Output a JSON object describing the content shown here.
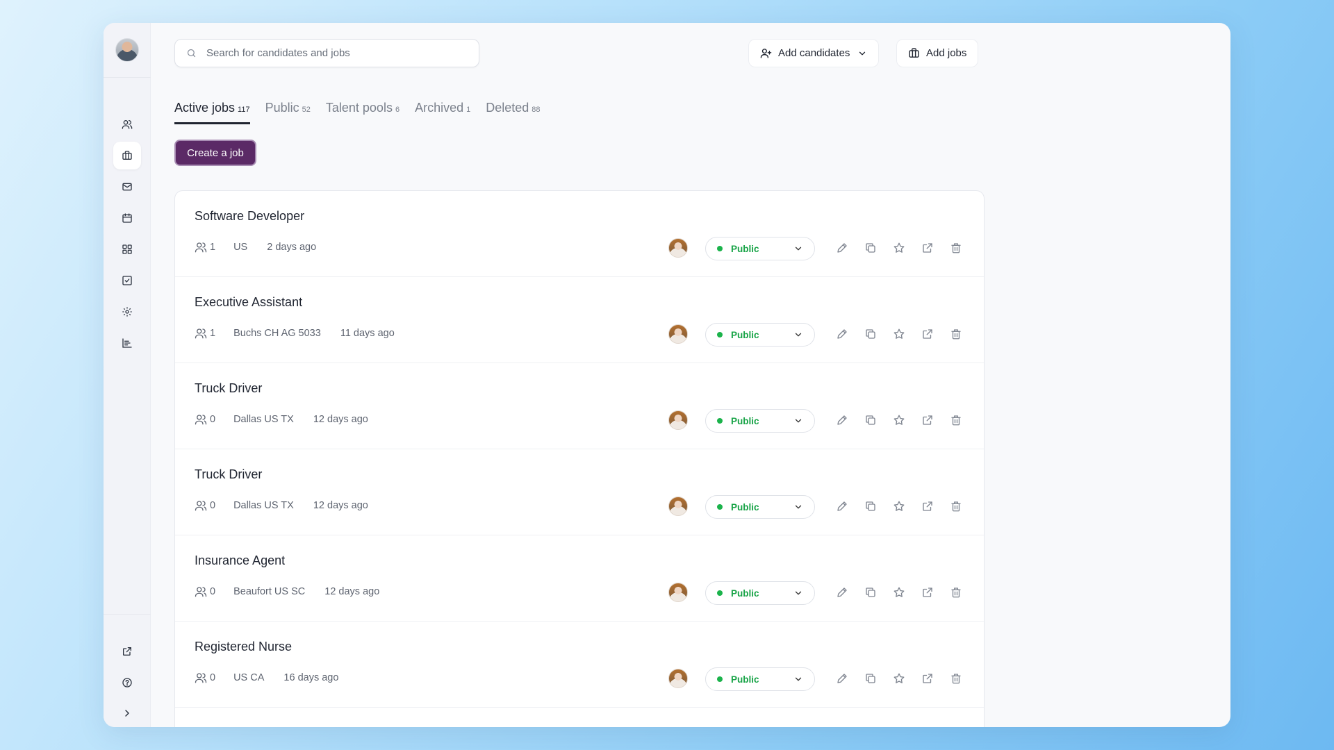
{
  "search": {
    "placeholder": "Search for candidates and jobs"
  },
  "header": {
    "add_candidates_label": "Add candidates",
    "add_jobs_label": "Add jobs"
  },
  "tabs": [
    {
      "label": "Active jobs",
      "count": "117",
      "active": true
    },
    {
      "label": "Public",
      "count": "52"
    },
    {
      "label": "Talent pools",
      "count": "6"
    },
    {
      "label": "Archived",
      "count": "1"
    },
    {
      "label": "Deleted",
      "count": "88"
    }
  ],
  "create_job_label": "Create a job",
  "sidebar": {
    "icons": [
      "users-icon",
      "briefcase-icon",
      "mail-icon",
      "calendar-icon",
      "apps-icon",
      "checkbox-icon",
      "gear-icon",
      "chart-icon"
    ],
    "bottom_icons": [
      "external-link-icon",
      "help-icon",
      "chevron-right-icon"
    ]
  },
  "jobs": [
    {
      "title": "Software Developer",
      "candidates": "1",
      "location": "US",
      "posted": "2 days ago",
      "status": "Public"
    },
    {
      "title": "Executive Assistant",
      "candidates": "1",
      "location": "Buchs CH AG 5033",
      "posted": "11 days ago",
      "status": "Public"
    },
    {
      "title": "Truck Driver",
      "candidates": "0",
      "location": "Dallas US TX",
      "posted": "12 days ago",
      "status": "Public"
    },
    {
      "title": "Truck Driver",
      "candidates": "0",
      "location": "Dallas US TX",
      "posted": "12 days ago",
      "status": "Public"
    },
    {
      "title": "Insurance Agent",
      "candidates": "0",
      "location": "Beaufort US SC",
      "posted": "12 days ago",
      "status": "Public"
    },
    {
      "title": "Registered Nurse",
      "candidates": "0",
      "location": "US CA",
      "posted": "16 days ago",
      "status": "Public"
    }
  ],
  "colors": {
    "accent": "#5b2a66",
    "status_green": "#17a346"
  }
}
